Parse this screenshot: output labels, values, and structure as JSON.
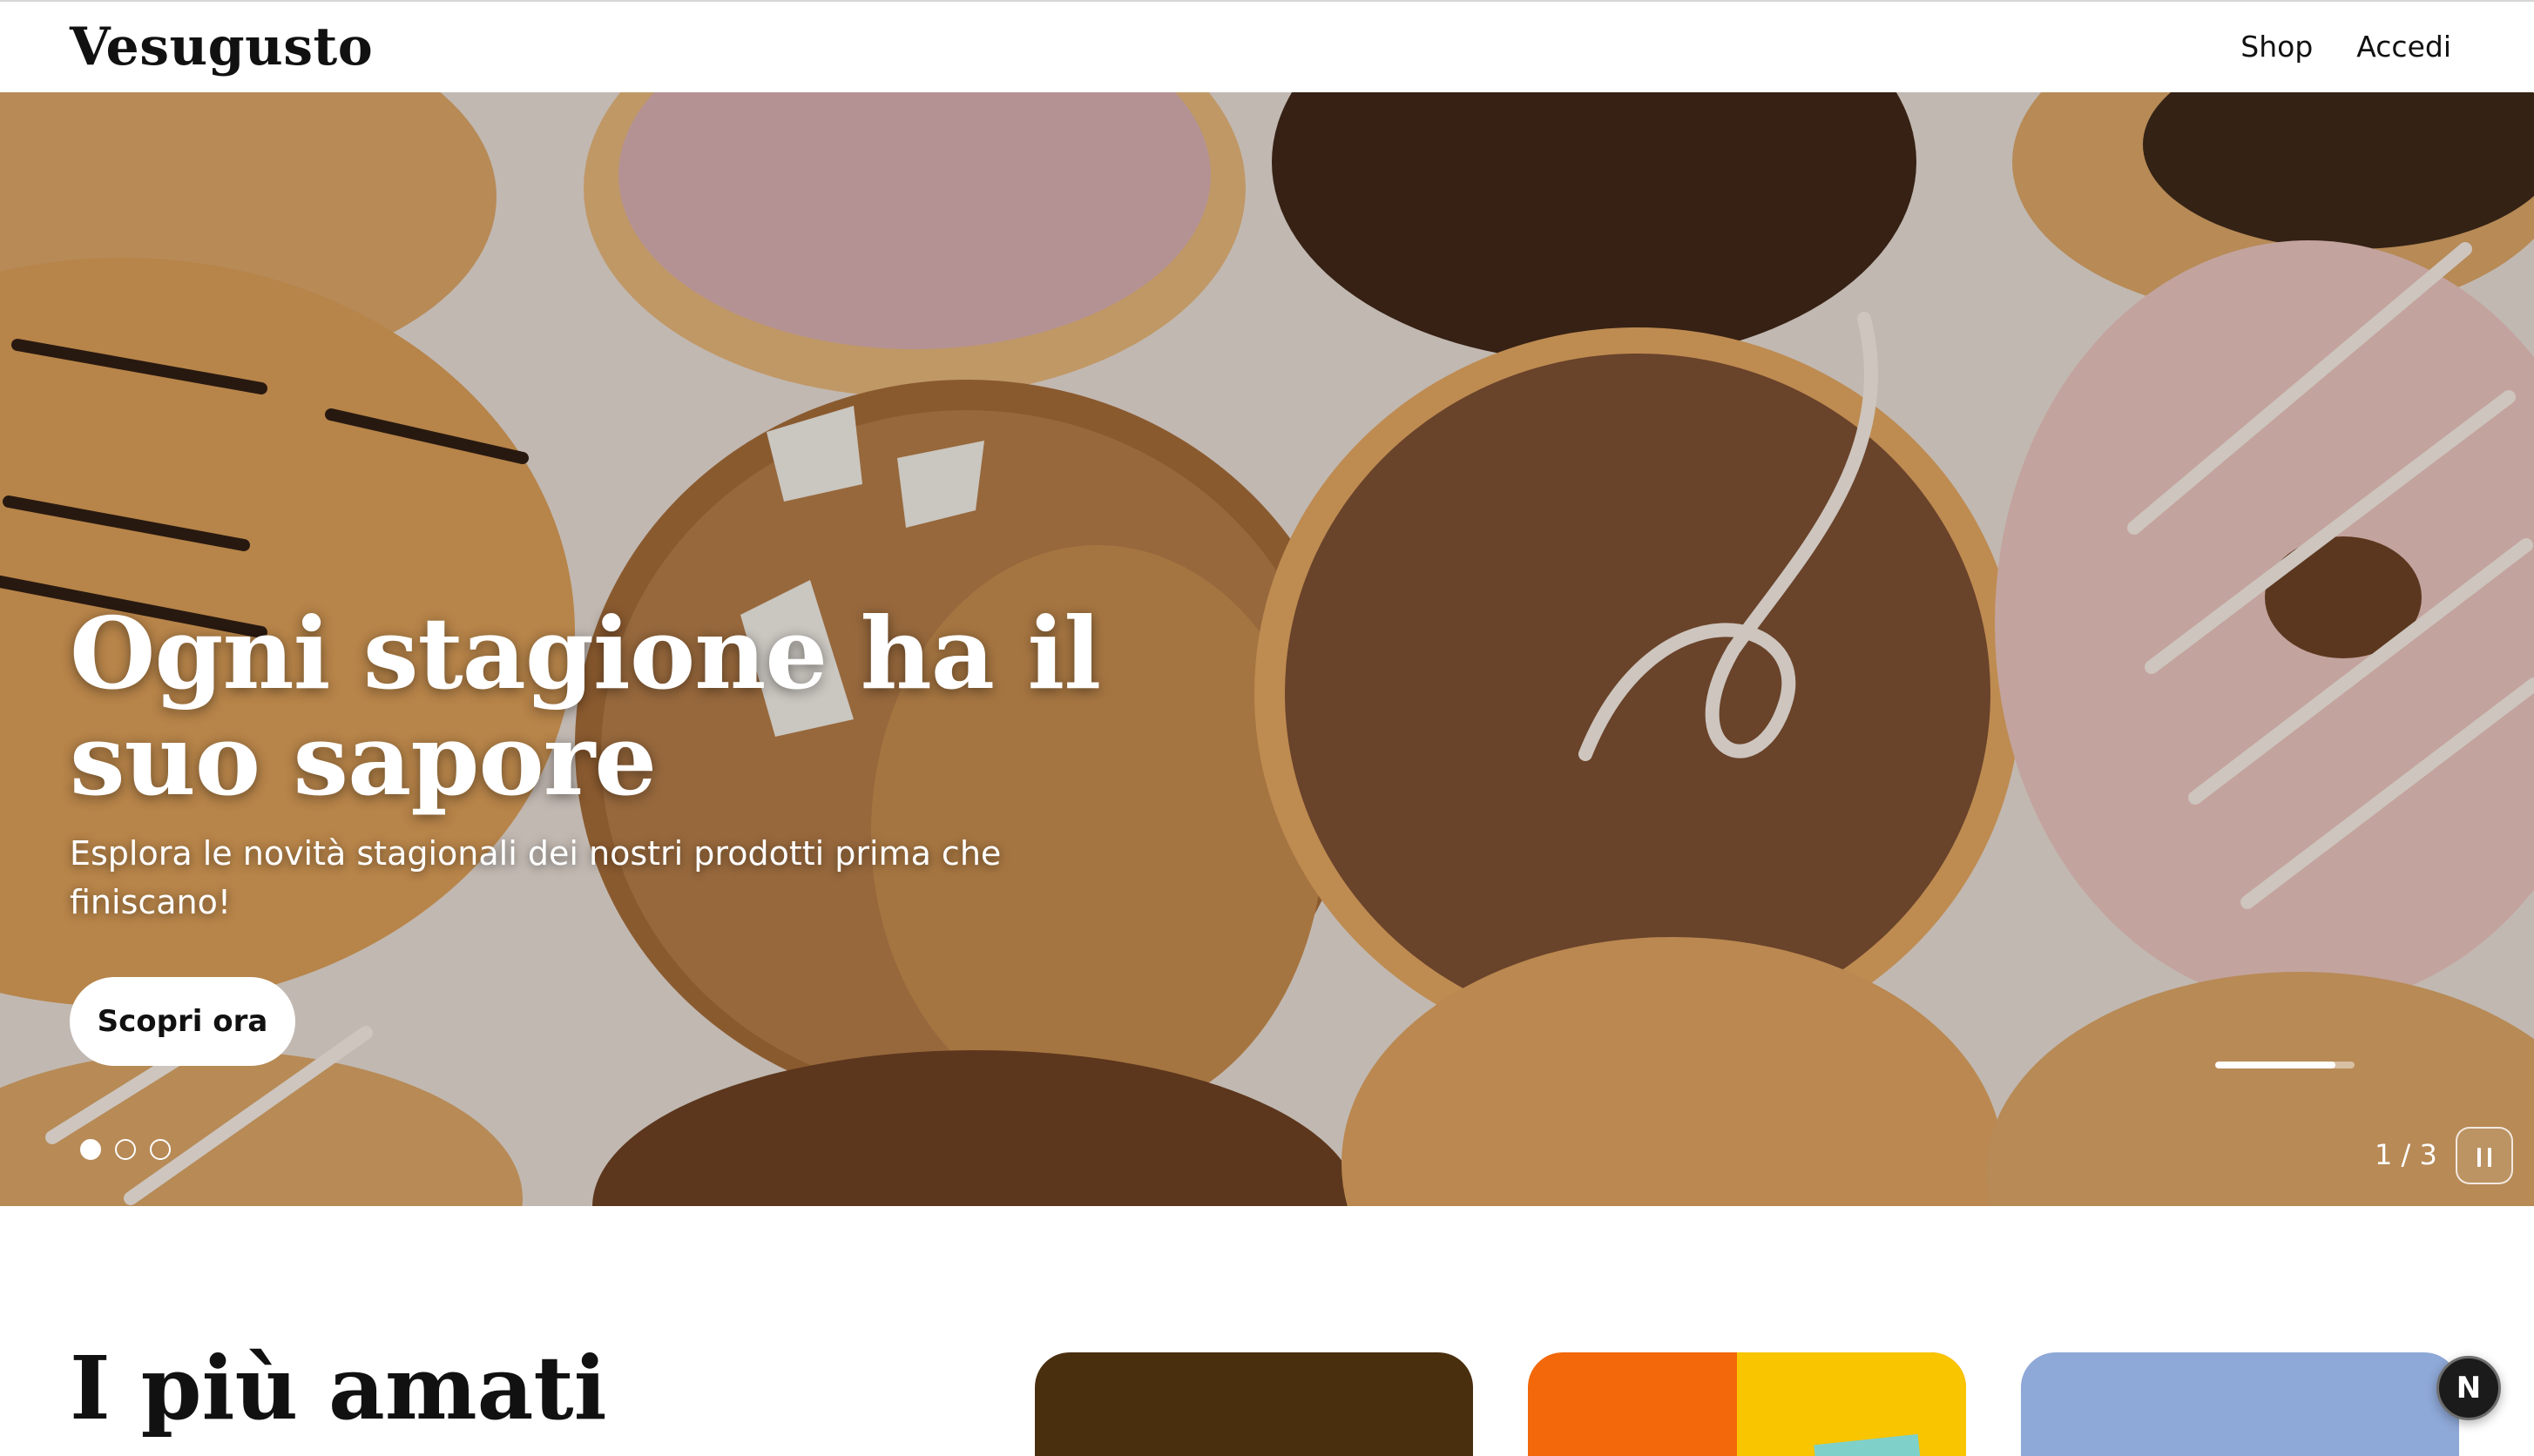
{
  "header": {
    "logo": "Vesugusto",
    "nav": {
      "shop": "Shop",
      "login": "Accedi"
    }
  },
  "hero": {
    "title": "Ogni stagione ha il suo sapore",
    "subtitle": "Esplora le novità stagionali dei nostri prodotti prima che finiscano!",
    "cta_label": "Scopri ora",
    "slides": {
      "current": 1,
      "total": 3,
      "counter_text": "1 / 3"
    },
    "progress": 0.86,
    "image_subject": "assorted glazed donuts top view"
  },
  "section": {
    "title": "I più amati"
  },
  "fab": {
    "letter": "N"
  },
  "colors": {
    "text": "#111111",
    "card_chocolate": "#4a2f0f",
    "card_orange": "#f2680a",
    "card_yellow": "#f9c400",
    "card_blue": "#8ea8d7"
  },
  "icons": [
    "pause-icon",
    "carousel-dot",
    "nextjs-badge-icon"
  ]
}
